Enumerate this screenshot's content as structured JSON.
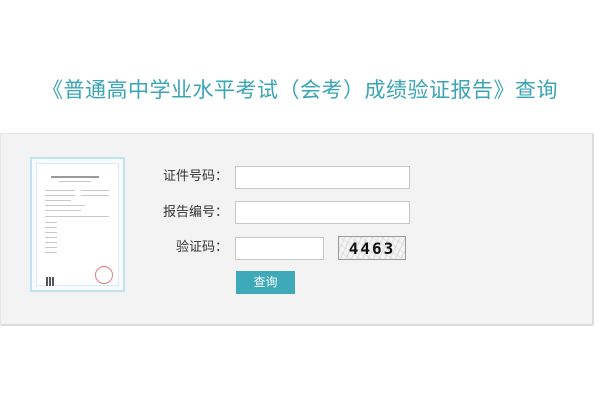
{
  "header": {
    "title": "《普通高中学业水平考试（会考）成绩验证报告》查询"
  },
  "form": {
    "id_number_label": "证件号码：",
    "report_number_label": "报告编号：",
    "captcha_label": "验证码：",
    "id_number_value": "",
    "report_number_value": "",
    "captcha_input_value": "",
    "captcha_image_text": "4463",
    "submit_label": "查询"
  },
  "colors": {
    "accent": "#3aa5b5",
    "panel_background": "#f3f3f3"
  }
}
